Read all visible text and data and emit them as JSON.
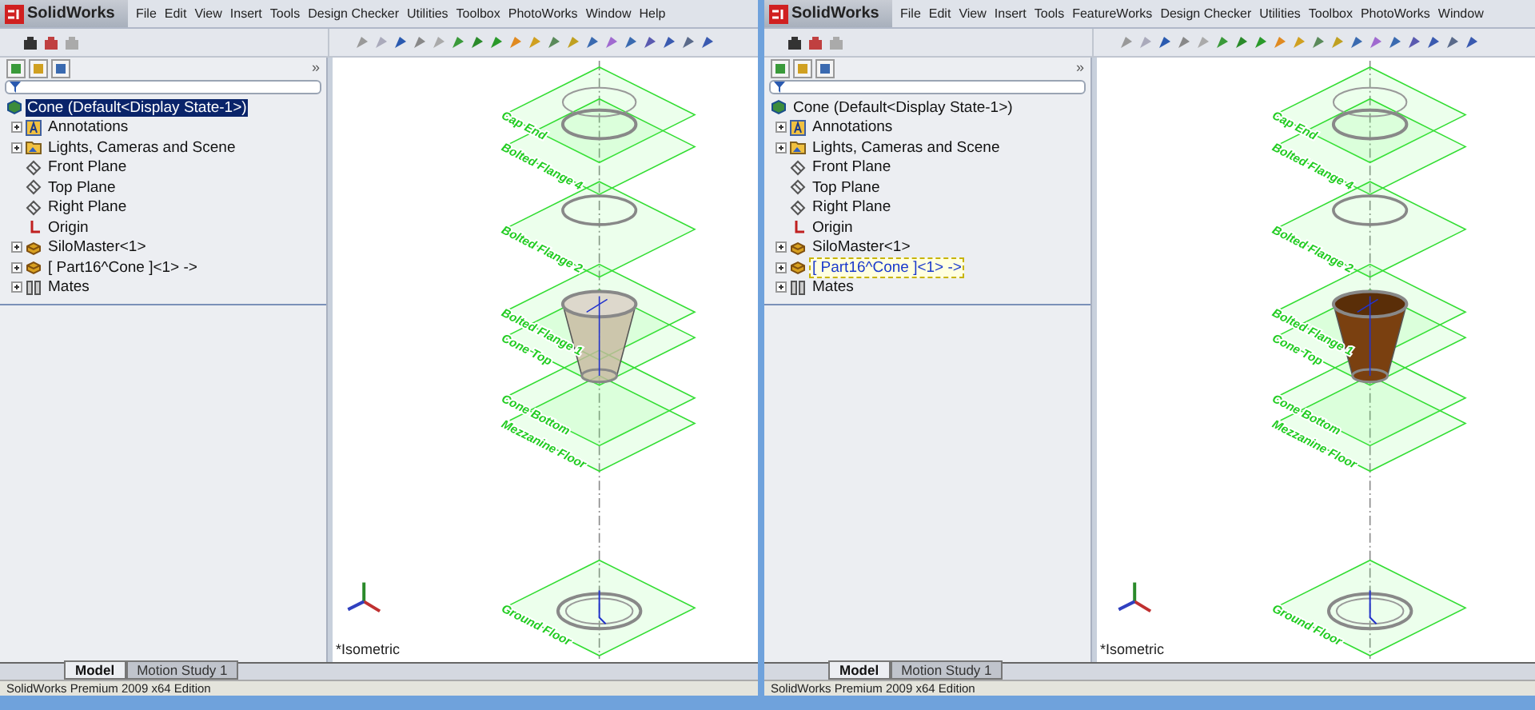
{
  "windows": [
    {
      "app_name": "SolidWorks",
      "menu": [
        "File",
        "Edit",
        "View",
        "Insert",
        "Tools",
        "Design Checker",
        "Utilities",
        "Toolbox",
        "PhotoWorks",
        "Window",
        "Help"
      ],
      "panel_expand": "»",
      "tree": {
        "label": "Cone  (Default<Display State-1>)",
        "kind": "part",
        "selected": true,
        "hovered": false,
        "children": [
          {
            "label": "Annotations",
            "kind": "annotations",
            "expanded": false,
            "selected": false,
            "hovered": false
          },
          {
            "label": "Lights, Cameras and Scene",
            "kind": "lights",
            "expanded": false,
            "selected": false,
            "hovered": false
          },
          {
            "label": "Front Plane",
            "kind": "plane",
            "selected": false,
            "hovered": false
          },
          {
            "label": "Top Plane",
            "kind": "plane",
            "selected": false,
            "hovered": false
          },
          {
            "label": "Right Plane",
            "kind": "plane",
            "selected": false,
            "hovered": false
          },
          {
            "label": "Origin",
            "kind": "origin",
            "selected": false,
            "hovered": false
          },
          {
            "label": "SiloMaster<1>",
            "kind": "component",
            "expanded": false,
            "selected": false,
            "hovered": false
          },
          {
            "label": "[ Part16^Cone ]<1> ->",
            "kind": "component",
            "expanded": false,
            "selected": false,
            "hovered": false
          },
          {
            "label": "Mates",
            "kind": "mates",
            "expanded": false,
            "selected": false,
            "hovered": false
          }
        ]
      },
      "viewport": {
        "planes": [
          {
            "label": "Cap End"
          },
          {
            "label": "Bolted Flange 4"
          },
          {
            "label": "Bolted Flange 2"
          },
          {
            "label": "Bolted Flange 1"
          },
          {
            "label": "Cone Top"
          },
          {
            "label": "Cone Bottom"
          },
          {
            "label": "Mezzanine Floor"
          },
          {
            "label": "Ground Floor"
          }
        ],
        "cone": {
          "kind": "translucent"
        },
        "view_label": "*Isometric"
      },
      "tabs": [
        {
          "label": "Model",
          "selected": true
        },
        {
          "label": "Motion Study 1",
          "selected": false
        }
      ],
      "status_bar": "SolidWorks Premium 2009 x64 Edition"
    },
    {
      "app_name": "SolidWorks",
      "menu": [
        "File",
        "Edit",
        "View",
        "Insert",
        "Tools",
        "FeatureWorks",
        "Design Checker",
        "Utilities",
        "Toolbox",
        "PhotoWorks",
        "Window"
      ],
      "panel_expand": "»",
      "tree": {
        "label": "Cone  (Default<Display State-1>)",
        "kind": "part",
        "selected": false,
        "hovered": false,
        "children": [
          {
            "label": "Annotations",
            "kind": "annotations",
            "expanded": false,
            "selected": false,
            "hovered": false
          },
          {
            "label": "Lights, Cameras and Scene",
            "kind": "lights",
            "expanded": false,
            "selected": false,
            "hovered": false
          },
          {
            "label": "Front Plane",
            "kind": "plane",
            "selected": false,
            "hovered": false
          },
          {
            "label": "Top Plane",
            "kind": "plane",
            "selected": false,
            "hovered": false
          },
          {
            "label": "Right Plane",
            "kind": "plane",
            "selected": false,
            "hovered": false
          },
          {
            "label": "Origin",
            "kind": "origin",
            "selected": false,
            "hovered": false
          },
          {
            "label": "SiloMaster<1>",
            "kind": "component",
            "expanded": false,
            "selected": false,
            "hovered": false
          },
          {
            "label": "[ Part16^Cone ]<1> ->",
            "kind": "component",
            "expanded": false,
            "selected": false,
            "hovered": true
          },
          {
            "label": "Mates",
            "kind": "mates",
            "expanded": false,
            "selected": false,
            "hovered": false
          }
        ]
      },
      "viewport": {
        "planes": [
          {
            "label": "Cap End"
          },
          {
            "label": "Bolted Flange 4"
          },
          {
            "label": "Bolted Flange 2"
          },
          {
            "label": "Bolted Flange 1"
          },
          {
            "label": "Cone Top"
          },
          {
            "label": "Cone Bottom"
          },
          {
            "label": "Mezzanine Floor"
          },
          {
            "label": "Ground Floor"
          }
        ],
        "cone": {
          "kind": "solid"
        },
        "view_label": "*Isometric"
      },
      "tabs": [
        {
          "label": "Model",
          "selected": true
        },
        {
          "label": "Motion Study 1",
          "selected": false
        }
      ],
      "status_bar": "SolidWorks Premium 2009 x64 Edition"
    }
  ]
}
